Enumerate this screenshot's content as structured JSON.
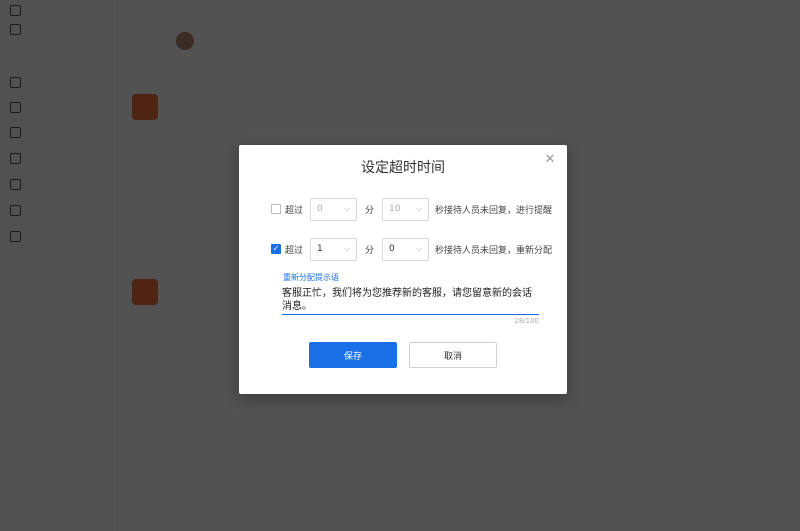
{
  "dialog": {
    "title": "设定超时时间",
    "row1": {
      "checked": false,
      "prefix": "超过",
      "minutes_value": "0",
      "unit": "分",
      "seconds_value": "10",
      "suffix": "秒接待人员未回复，进行提醒"
    },
    "row2": {
      "checked": true,
      "prefix": "超过",
      "minutes_value": "1",
      "unit": "分",
      "seconds_value": "0",
      "suffix": "秒接待人员未回复，重新分配"
    },
    "hint_label": "重新分配提示语",
    "hint_text": "客服正忙，我们将为您推荐新的客服，请您留意新的会话消息。",
    "counter": "28/100",
    "save_label": "保存",
    "cancel_label": "取消"
  },
  "colors": {
    "primary": "#1a6fe6",
    "overlay": "rgba(0,0,0,0.68)"
  },
  "icons": [
    "close-icon",
    "chevron-down-icon",
    "checkbox-check-icon"
  ]
}
